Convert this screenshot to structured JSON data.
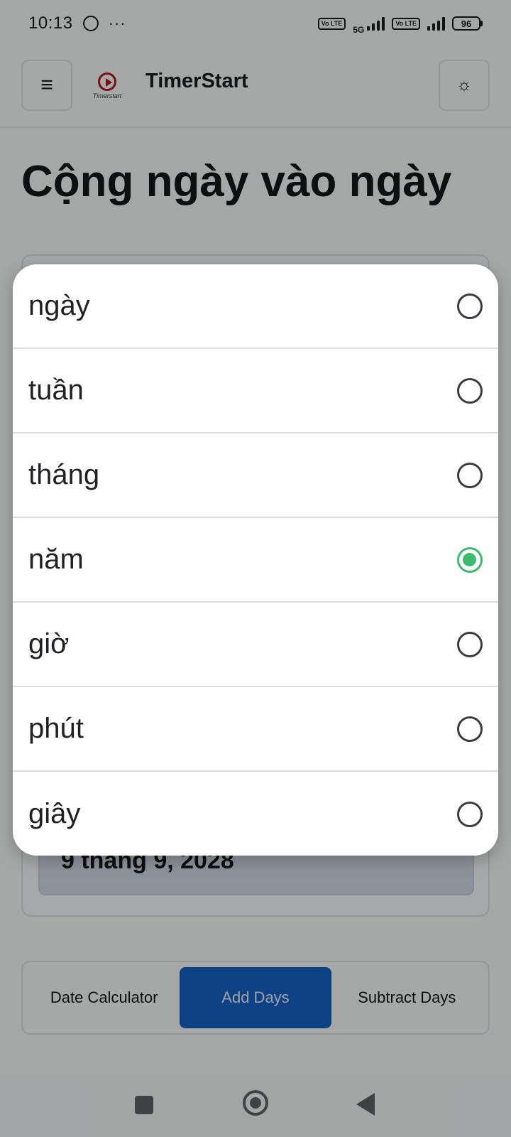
{
  "status_bar": {
    "time": "10:13",
    "more": "···",
    "volte1": "Vo LTE",
    "network": "5G",
    "volte2": "Vo LTE",
    "battery": "96"
  },
  "header": {
    "menu_icon": "≡",
    "logo_text": "Timerstart",
    "title": "TimerStart",
    "theme_icon": "☼"
  },
  "page": {
    "title": "Cộng ngày vào ngày",
    "result_date": "9 tháng 9, 2028"
  },
  "tabs": [
    {
      "label": "Date Calculator",
      "active": false
    },
    {
      "label": "Add Days",
      "active": true
    },
    {
      "label": "Subtract Days",
      "active": false
    }
  ],
  "dialog": {
    "selected": "năm",
    "options": [
      {
        "label": "ngày"
      },
      {
        "label": "tuần"
      },
      {
        "label": "tháng"
      },
      {
        "label": "năm"
      },
      {
        "label": "giờ"
      },
      {
        "label": "phút"
      },
      {
        "label": "giây"
      }
    ]
  },
  "colors": {
    "accent_tab": "#1762c4",
    "radio_selected": "#3cba6e",
    "logo_red": "#b3161d"
  }
}
